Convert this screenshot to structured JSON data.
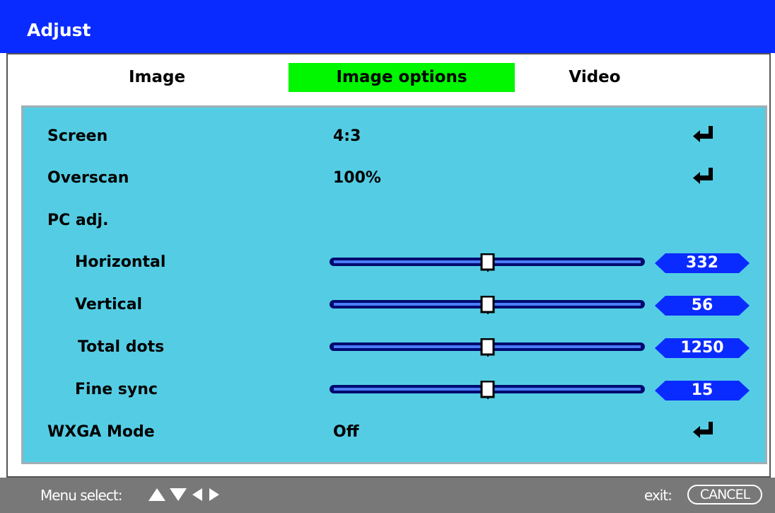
{
  "window": {
    "title": "Adjust"
  },
  "tabs": [
    {
      "label": "Image"
    },
    {
      "label": "Image options",
      "selected": true
    },
    {
      "label": "Video"
    }
  ],
  "rows": {
    "screen": {
      "label": "Screen",
      "value": "4:3"
    },
    "overscan": {
      "label": "Overscan",
      "value": "100%"
    },
    "pc_adj": {
      "label": "PC adj."
    },
    "horizontal": {
      "label": "Horizontal",
      "value": "332"
    },
    "vertical": {
      "label": "Vertical",
      "value": "56"
    },
    "total_dots": {
      "label": "Total dots",
      "value": "1250"
    },
    "fine_sync": {
      "label": "Fine sync",
      "value": "15"
    },
    "wxga_mode": {
      "label": "WXGA Mode",
      "value": "Off"
    }
  },
  "status": {
    "menu_select": "Menu select:",
    "exit_label": "exit:",
    "cancel_label": "CANCEL"
  },
  "colors": {
    "title_bar": "#0a2bff",
    "selected_tab": "#00f700",
    "panel_bg": "#54cde4",
    "value_box": "#0a2bff",
    "status_bar": "#787878"
  }
}
